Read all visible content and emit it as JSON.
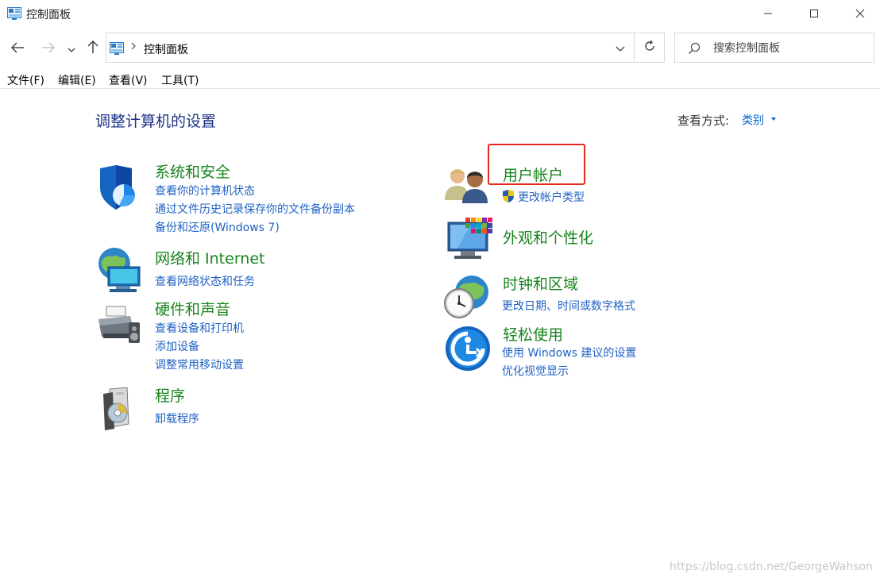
{
  "window": {
    "title": "控制面板",
    "icon": "control-panel-icon"
  },
  "nav": {
    "breadcrumb_item": "控制面板",
    "search_placeholder": "搜索控制面板"
  },
  "menu": {
    "items": [
      "文件(F)",
      "编辑(E)",
      "查看(V)",
      "工具(T)"
    ]
  },
  "main": {
    "heading": "调整计算机的设置",
    "view_by_label": "查看方式:",
    "view_by_value": "类别",
    "left_categories": [
      {
        "title": "系统和安全",
        "icon": "shield-icon",
        "links": [
          "查看你的计算机状态",
          "通过文件历史记录保存你的文件备份副本",
          "备份和还原(Windows 7)"
        ]
      },
      {
        "title": "网络和 Internet",
        "icon": "network-globe-icon",
        "links": [
          "查看网络状态和任务"
        ]
      },
      {
        "title": "硬件和声音",
        "icon": "printer-icon",
        "links": [
          "查看设备和打印机",
          "添加设备",
          "调整常用移动设置"
        ]
      },
      {
        "title": "程序",
        "icon": "programs-disc-icon",
        "links": [
          "卸载程序"
        ]
      }
    ],
    "right_categories": [
      {
        "title": "用户帐户",
        "icon": "users-icon",
        "links": [
          "更改帐户类型"
        ]
      },
      {
        "title": "外观和个性化",
        "icon": "monitor-palette-icon",
        "links": []
      },
      {
        "title": "时钟和区域",
        "icon": "clock-globe-icon",
        "links": [
          "更改日期、时间或数字格式"
        ]
      },
      {
        "title": "轻松使用",
        "icon": "accessibility-icon",
        "links": [
          "使用 Windows 建议的设置",
          "优化视觉显示"
        ]
      }
    ]
  },
  "watermark": "https://blog.csdn.net/GeorgeWahson",
  "colors": {
    "category_title": "#19851d",
    "link": "#1f62c4",
    "heading": "#1e3287",
    "highlight": "#e8281e"
  }
}
